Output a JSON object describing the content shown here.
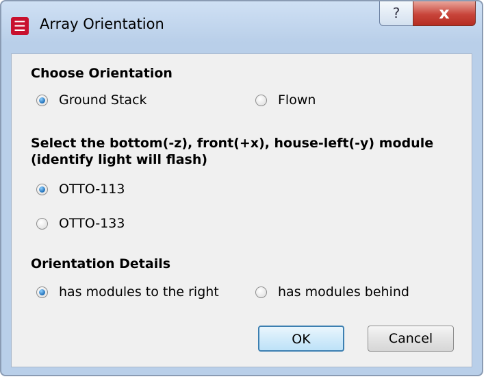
{
  "window": {
    "title": "Array Orientation",
    "help_label": "?",
    "close_label": "x"
  },
  "sections": {
    "orientation": {
      "heading": "Choose Orientation",
      "options": [
        {
          "label": "Ground Stack",
          "checked": true
        },
        {
          "label": "Flown",
          "checked": false
        }
      ]
    },
    "module": {
      "heading_line1": "Select the bottom(-z), front(+x), house-left(-y) module",
      "heading_line2": "(identify light will flash)",
      "options": [
        {
          "label": "OTTO-113",
          "checked": true
        },
        {
          "label": "OTTO-133",
          "checked": false
        }
      ]
    },
    "details": {
      "heading": "Orientation Details",
      "options": [
        {
          "label": "has modules to the right",
          "checked": true
        },
        {
          "label": "has modules behind",
          "checked": false
        }
      ]
    }
  },
  "buttons": {
    "ok_label": "OK",
    "cancel_label": "Cancel"
  },
  "colors": {
    "accent": "#1f6fb8",
    "close": "#c8443a",
    "app_icon": "#c8102e"
  }
}
